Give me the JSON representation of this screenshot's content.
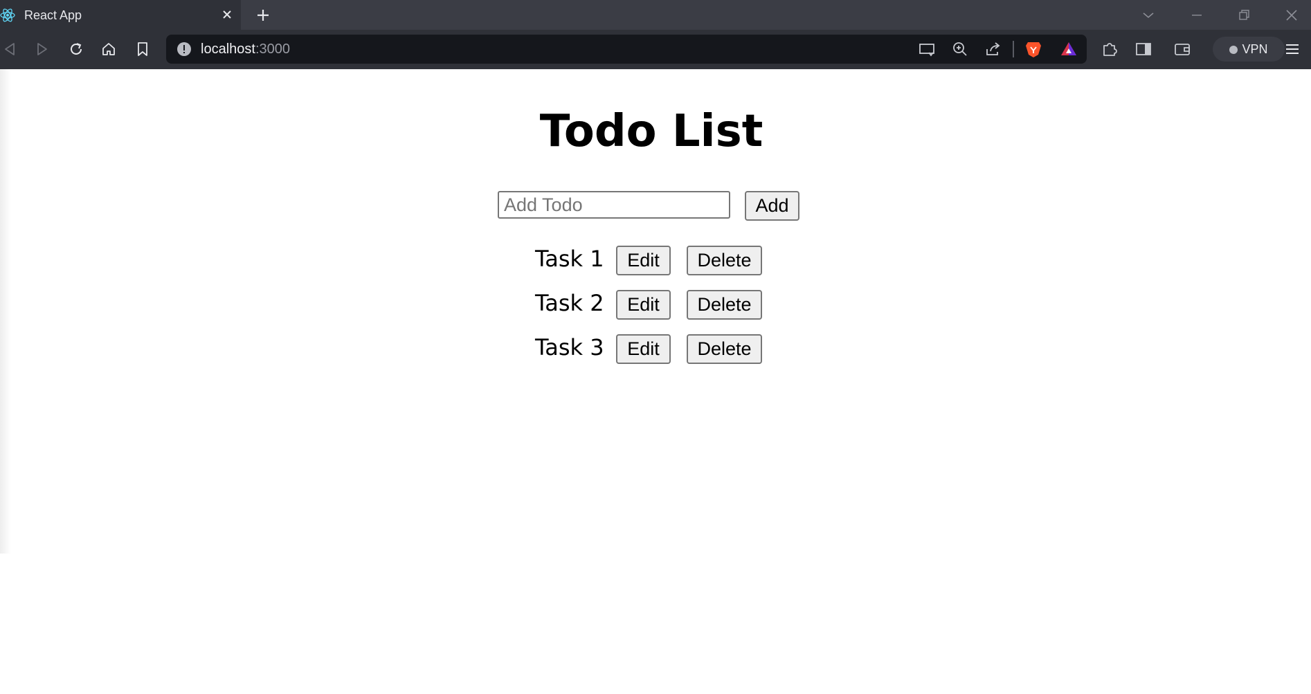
{
  "browser": {
    "tab_title": "React App",
    "url_host": "localhost",
    "url_port": ":3000",
    "vpn_label": "VPN",
    "icons": {
      "favicon": "react-logo-icon",
      "tab_close": "close-icon",
      "new_tab": "plus-icon",
      "back": "back-arrow-icon",
      "forward": "forward-arrow-icon",
      "reload": "reload-icon",
      "home": "home-icon",
      "bookmark": "bookmark-icon",
      "site_info": "info-icon",
      "cast": "cast-icon",
      "zoom": "zoom-in-icon",
      "share": "share-icon",
      "brave_shields": "brave-lion-icon",
      "rewards": "brave-rewards-triangle-icon",
      "extensions": "puzzle-icon",
      "sidebar": "sidebar-icon",
      "wallet": "wallet-icon",
      "menu": "hamburger-menu-icon"
    }
  },
  "app": {
    "title": "Todo List",
    "input_placeholder": "Add Todo",
    "add_label": "Add",
    "todos": [
      {
        "text": "Task 1",
        "edit_label": "Edit",
        "delete_label": "Delete"
      },
      {
        "text": "Task 2",
        "edit_label": "Edit",
        "delete_label": "Delete"
      },
      {
        "text": "Task 3",
        "edit_label": "Edit",
        "delete_label": "Delete"
      }
    ]
  }
}
